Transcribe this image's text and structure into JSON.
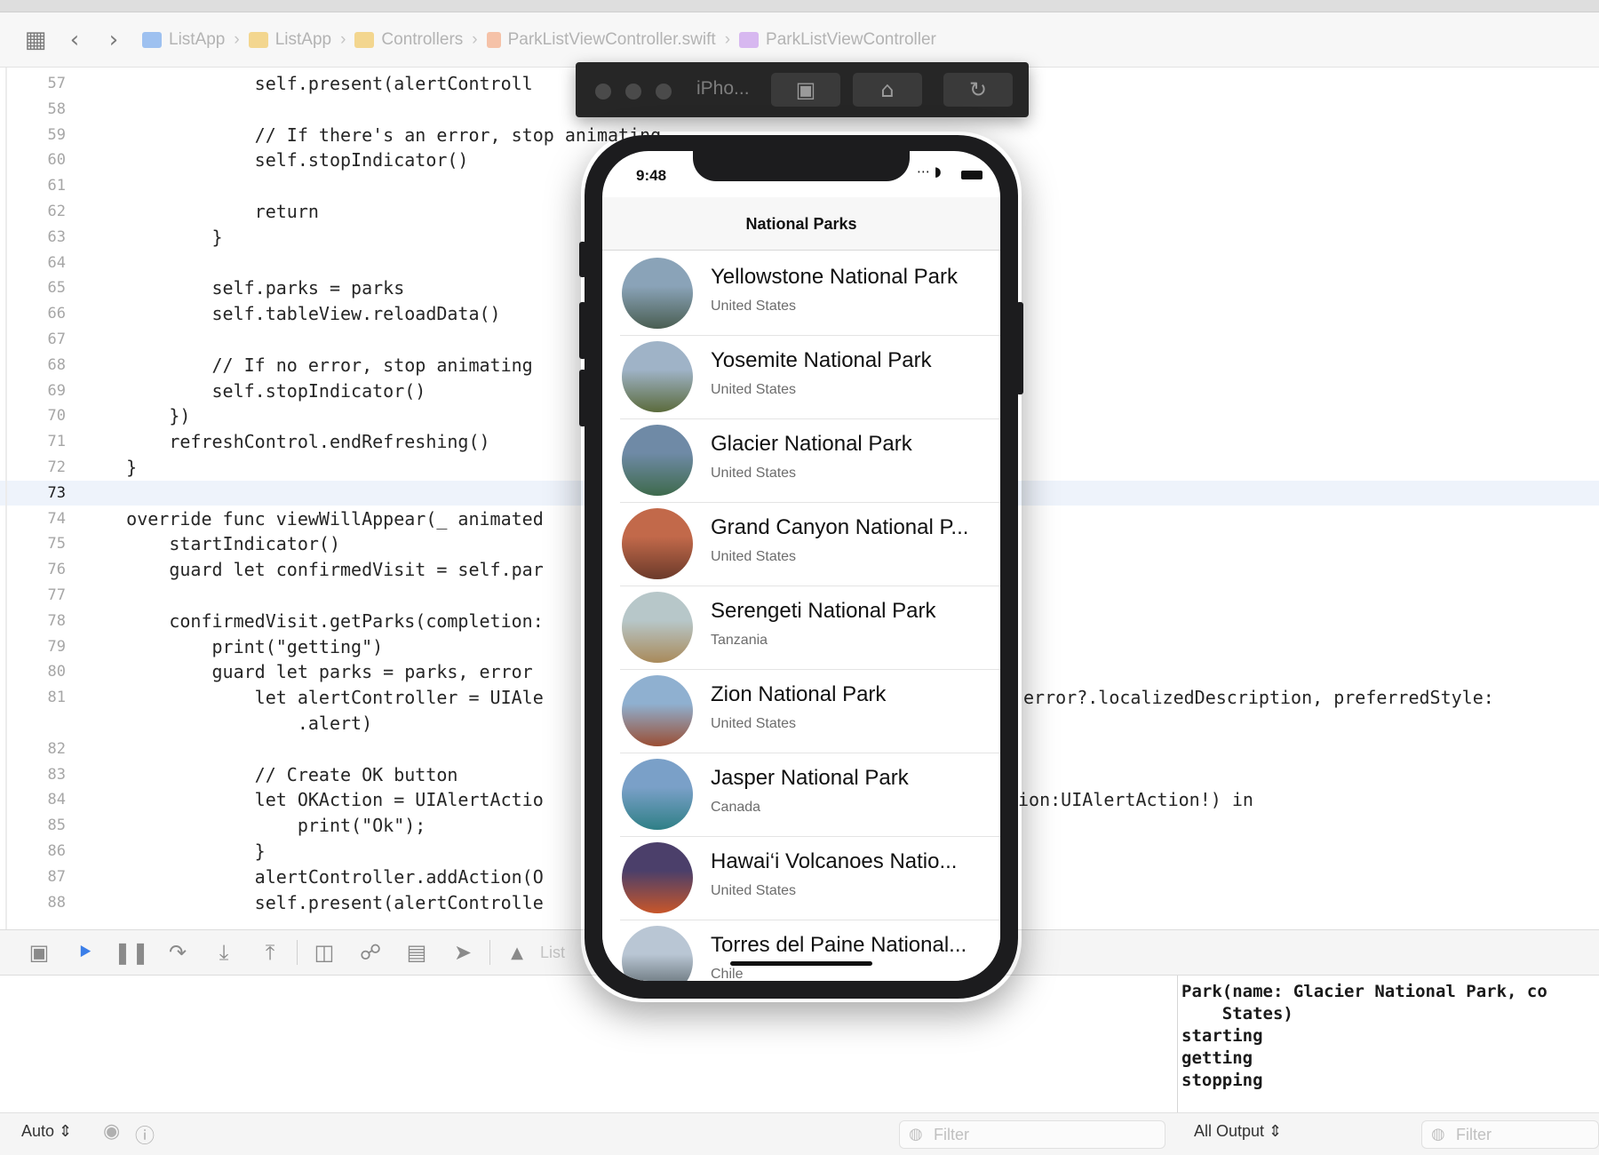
{
  "breadcrumb": [
    "ListApp",
    "ListApp",
    "Controllers",
    "ParkListViewController.swift",
    "ParkListViewController"
  ],
  "editor": {
    "current_line": "73",
    "lines": [
      {
        "n": "57",
        "code": "                self.present(alertControll"
      },
      {
        "n": "58",
        "code": ""
      },
      {
        "n": "59",
        "code": "                // If there's an error, stop animating"
      },
      {
        "n": "60",
        "code": "                self.stopIndicator()"
      },
      {
        "n": "61",
        "code": ""
      },
      {
        "n": "62",
        "code": "                return"
      },
      {
        "n": "63",
        "code": "            }"
      },
      {
        "n": "64",
        "code": ""
      },
      {
        "n": "65",
        "code": "            self.parks = parks"
      },
      {
        "n": "66",
        "code": "            self.tableView.reloadData()"
      },
      {
        "n": "67",
        "code": ""
      },
      {
        "n": "68",
        "code": "            // If no error, stop animating"
      },
      {
        "n": "69",
        "code": "            self.stopIndicator()"
      },
      {
        "n": "70",
        "code": "        })"
      },
      {
        "n": "71",
        "code": "        refreshControl.endRefreshing()"
      },
      {
        "n": "72",
        "code": "    }"
      },
      {
        "n": "73",
        "code": ""
      },
      {
        "n": "74",
        "code": "    override func viewWillAppear(_ animated"
      },
      {
        "n": "75",
        "code": "        startIndicator()"
      },
      {
        "n": "76",
        "code": "        guard let confirmedVisit = self.par"
      },
      {
        "n": "77",
        "code": ""
      },
      {
        "n": "78",
        "code": "        confirmedVisit.getParks(completion:"
      },
      {
        "n": "79",
        "code": "            print(\"getting\")"
      },
      {
        "n": "80",
        "code": "            guard let parks = parks, error"
      },
      {
        "n": "81",
        "code": "                let alertController = UIAle",
        "right": "error?.localizedDescription, preferredStyle:"
      },
      {
        "n": "",
        "code": "                    .alert)"
      },
      {
        "n": "82",
        "code": ""
      },
      {
        "n": "83",
        "code": "                // Create OK button"
      },
      {
        "n": "84",
        "code": "                let OKAction = UIAlertActio",
        "right": "ion:UIAlertAction!) in"
      },
      {
        "n": "85",
        "code": "                    print(\"Ok\");"
      },
      {
        "n": "86",
        "code": "                }"
      },
      {
        "n": "87",
        "code": "                alertController.addAction(O"
      },
      {
        "n": "88",
        "code": "                self.present(alertControlle"
      }
    ]
  },
  "debugbar": {
    "icons": [
      "hide-debug-area",
      "breakpoints-toggle",
      "pause",
      "step-over",
      "step-into",
      "step-out",
      "debug-view-hierarchy",
      "memory-graph",
      "environment-overrides",
      "simulate-location"
    ],
    "target": "List"
  },
  "console": {
    "lines": [
      "Park(name: Glacier National Park, co",
      "    States)",
      "starting",
      "getting",
      "stopping"
    ]
  },
  "bottom": {
    "auto_label": "Auto ⇕",
    "filter_placeholder": "Filter",
    "output_label": "All Output ⇕",
    "filter2_placeholder": "Filter"
  },
  "simulator": {
    "title": "iPho...",
    "status_time": "9:48",
    "nav_title": "National Parks",
    "parks": [
      {
        "name": "Yellowstone National Park",
        "country": "United States",
        "thumb_colors": [
          "#8aa3b8",
          "#4a5e52"
        ]
      },
      {
        "name": "Yosemite National Park",
        "country": "United States",
        "thumb_colors": [
          "#9fb3c7",
          "#5b6b3c"
        ]
      },
      {
        "name": "Glacier National Park",
        "country": "United States",
        "thumb_colors": [
          "#6f8aa6",
          "#3e6a4c"
        ]
      },
      {
        "name": "Grand Canyon National P...",
        "country": "United States",
        "thumb_colors": [
          "#c2694a",
          "#6b3a2a"
        ]
      },
      {
        "name": "Serengeti National Park",
        "country": "Tanzania",
        "thumb_colors": [
          "#b7c7c9",
          "#a98a5a"
        ]
      },
      {
        "name": "Zion National Park",
        "country": "United States",
        "thumb_colors": [
          "#8fb0d0",
          "#9a4e34"
        ]
      },
      {
        "name": "Jasper National Park",
        "country": "Canada",
        "thumb_colors": [
          "#7aa0c8",
          "#2f7f86"
        ]
      },
      {
        "name": "Hawai‘i Volcanoes Natio...",
        "country": "United States",
        "thumb_colors": [
          "#4b3f6a",
          "#c8562a"
        ]
      },
      {
        "name": "Torres del Paine National...",
        "country": "Chile",
        "thumb_colors": [
          "#b9c6d4",
          "#4f5a5e"
        ]
      }
    ]
  }
}
